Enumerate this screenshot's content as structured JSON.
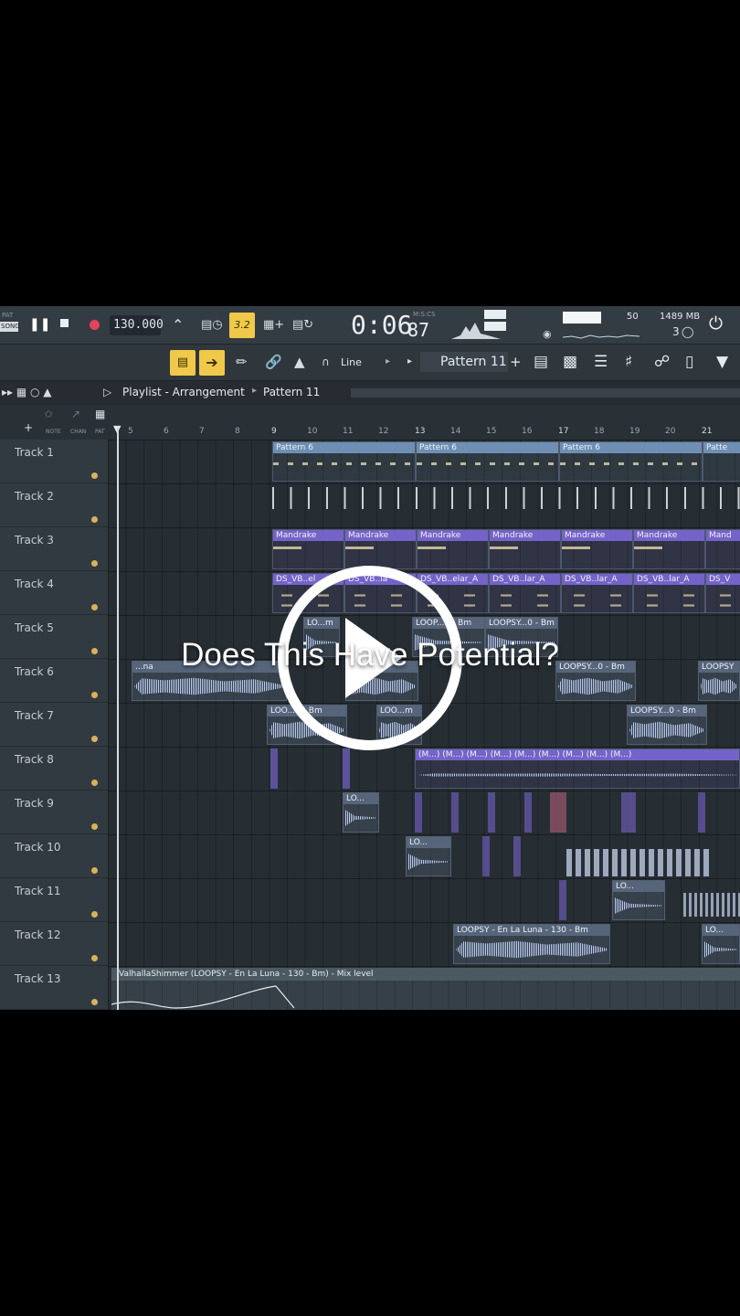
{
  "toolbar": {
    "pat_label": "PAT",
    "song_label": "SONG",
    "tempo": "130.000",
    "snap_badge": "3.2",
    "time_display": "0:06",
    "time_centis": "87",
    "time_format": "M:S:CS",
    "cpu_value": "50",
    "memory": "1489 MB",
    "voices": "3",
    "tool_mode": "Line",
    "pattern_selector": "Pattern 11"
  },
  "playlist": {
    "title": "Playlist - Arrangement",
    "breadcrumb_sep": "▸",
    "pattern": "Pattern 11",
    "tabs": [
      "NOTE",
      "CHAN",
      "PAT"
    ]
  },
  "ruler": {
    "bars": [
      "5",
      "6",
      "7",
      "8",
      "9",
      "10",
      "11",
      "12",
      "13",
      "14",
      "15",
      "16",
      "17",
      "18",
      "19",
      "20",
      "21"
    ]
  },
  "tracks": [
    "Track 1",
    "Track 2",
    "Track 3",
    "Track 4",
    "Track 5",
    "Track 6",
    "Track 7",
    "Track 8",
    "Track 9",
    "Track 10",
    "Track 11",
    "Track 12",
    "Track 13"
  ],
  "clips": {
    "pattern6": "Pattern 6",
    "pattern6_cut": "Patte",
    "mandrake": "Mandrake",
    "mandrake_cut": "Mand",
    "ds1": "DS_VB..el",
    "ds2": "DS_VB..la",
    "ds3": "DS_VB..elar_A",
    "ds4": "DS_VB..lar_A",
    "ds5": "DS_VB..lar_A",
    "ds6": "DS_VB..lar_A",
    "ds_cut": "DS_V",
    "t5a": "LO...m",
    "t5b": "LOOP...0 - Bm",
    "t5c": "LOOPSY...0 - Bm",
    "t6a": "...na",
    "t6b": "...Bm",
    "t6c": "LOOPSY...0 - Bm",
    "t6d": "LOOPSY",
    "t7a": "LOO...0 - Bm",
    "t7b": "LOO...m",
    "t7c": "LOOPSY...0 - Bm",
    "t8": "(M...)",
    "t9": "LO...",
    "t10": "LO...",
    "t11": "LO...",
    "t12a": "LOOPSY - En La Luna - 130 - Bm",
    "t12b": "LO...",
    "automation": "ValhallaShimmer (LOOPSY - En La Luna - 130 - Bm) - Mix level"
  },
  "overlay": {
    "caption": "Does This Have Potential?"
  }
}
